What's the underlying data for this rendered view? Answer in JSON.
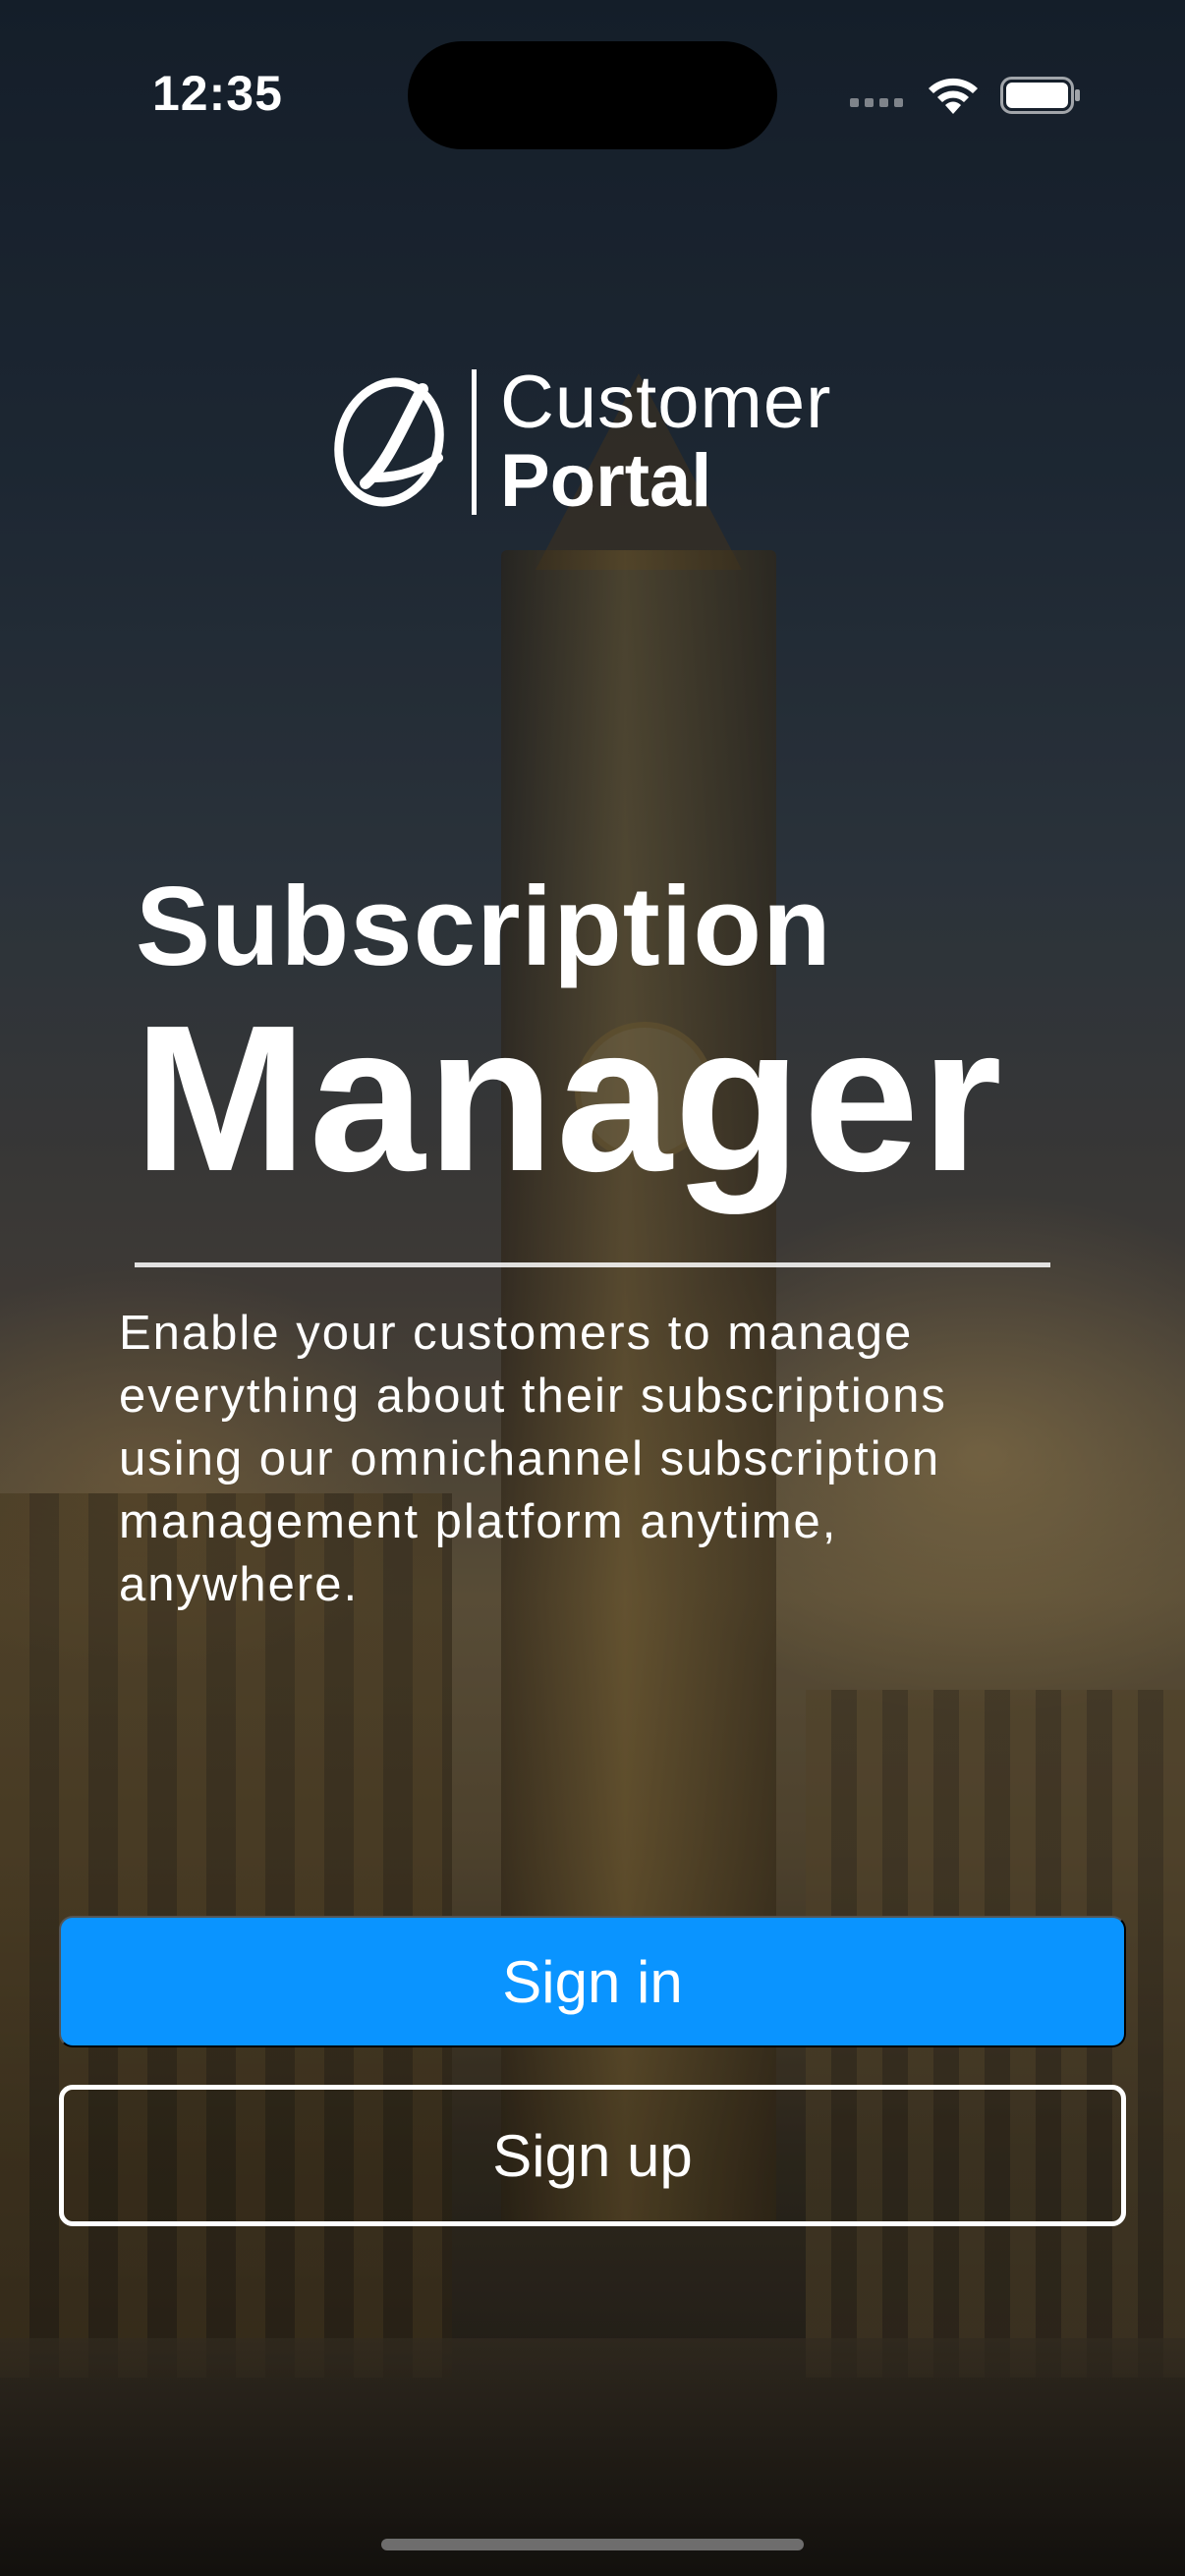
{
  "status_bar": {
    "time": "12:35"
  },
  "logo": {
    "line1": "Customer",
    "line2": "Portal"
  },
  "headline": {
    "line1": "Subscription",
    "line2": "Manager"
  },
  "description": "Enable your customers to manage everything about their subscriptions using our omnichannel subscription management platform anytime, anywhere.",
  "buttons": {
    "sign_in": "Sign in",
    "sign_up": "Sign up"
  },
  "colors": {
    "primary_button": "#0a94ff",
    "text": "#ffffff"
  }
}
